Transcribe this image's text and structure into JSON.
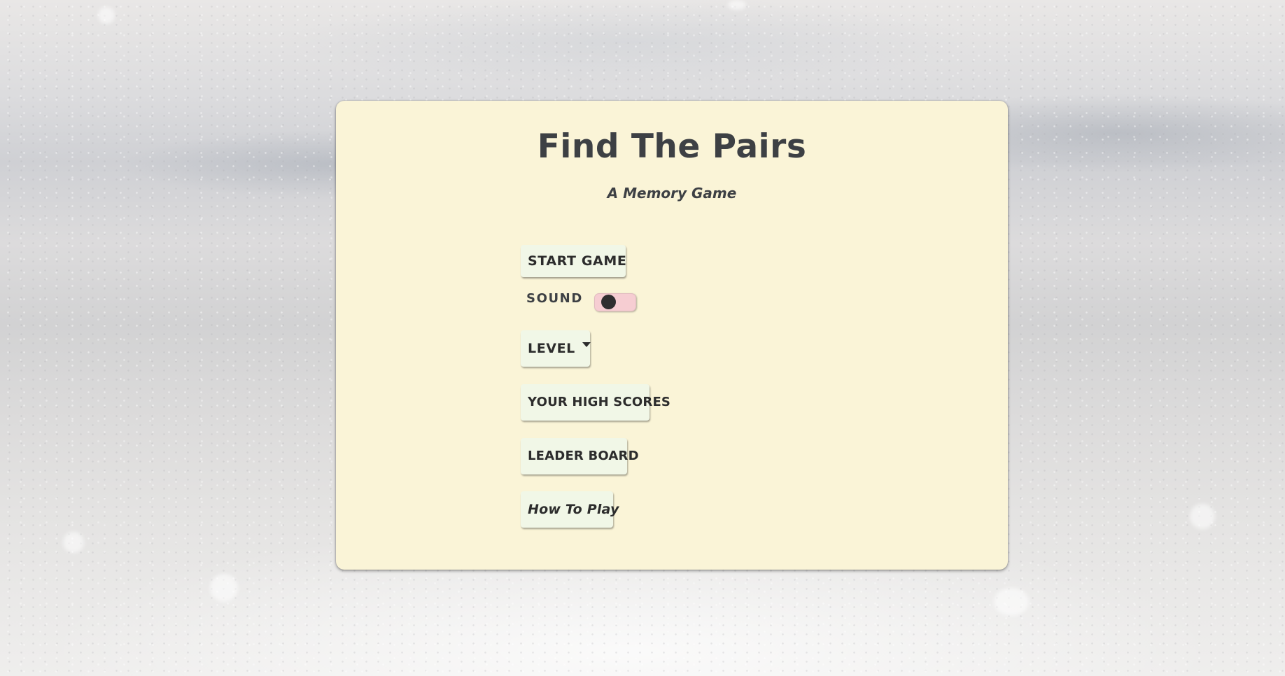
{
  "game": {
    "title": "Find The Pairs",
    "subtitle": "A Memory Game"
  },
  "menu": {
    "start_label": "START GAME",
    "sound_label": "SOUND",
    "sound_enabled": false,
    "level_label": "LEVEL",
    "high_scores_label": "YOUR HIGH SCORES",
    "leader_board_label": "LEADER BOARD",
    "how_to_play_label": "How To Play"
  },
  "colors": {
    "card_background": "#faf4d7",
    "button_background": "#f1f7e7",
    "toggle_track": "#f6cdd2",
    "toggle_knob": "#2f2e2f",
    "text": "#3d4044"
  },
  "icons": {
    "level_dropdown": "chevron-down-icon"
  }
}
